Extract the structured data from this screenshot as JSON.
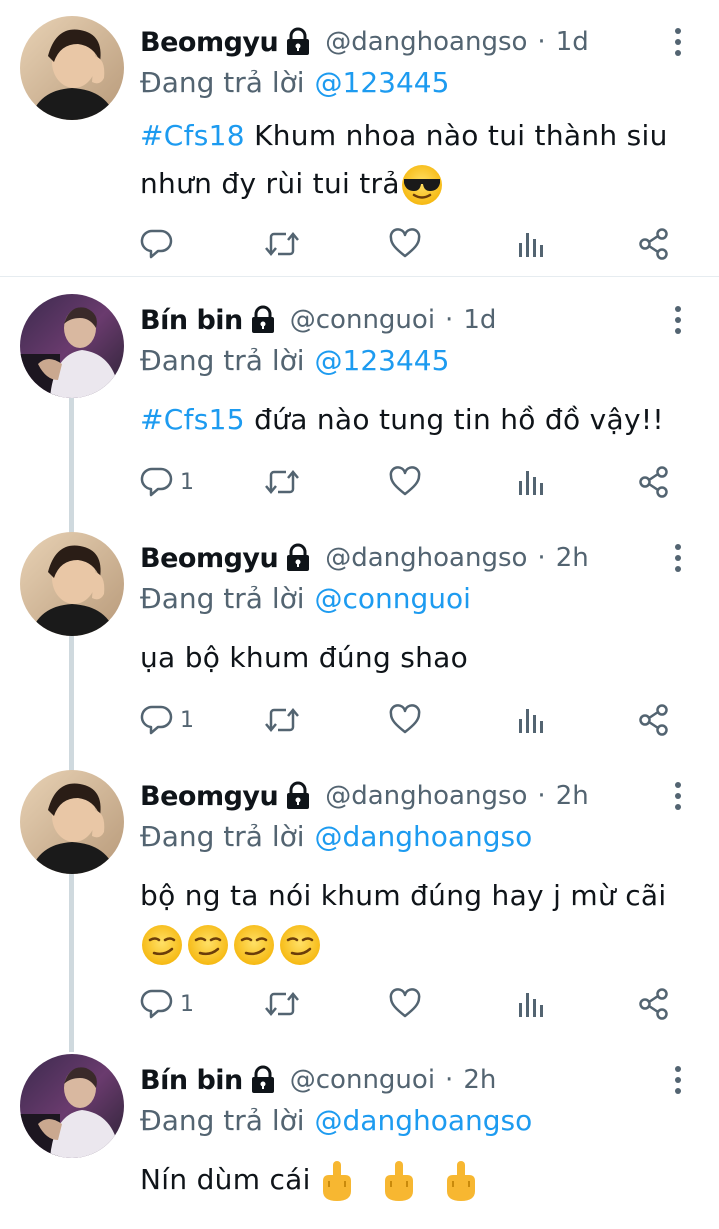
{
  "tweets": [
    {
      "name": "Beomgyu",
      "handle": "@danghoangso",
      "dot": "·",
      "time": "1d",
      "replying_label": "Đang trả lời",
      "replying_to": "@123445",
      "hashtag": "#Cfs18",
      "text": " Khum nhoa nào tui thành siu nhưn đy rùi tui trả",
      "emoji": "sunglasses-face",
      "reply_count": "",
      "avatar": "beomgyu"
    },
    {
      "name": "Bín bin",
      "handle": "@connguoi",
      "dot": "·",
      "time": "1d",
      "replying_label": "Đang trả lời",
      "replying_to": "@123445",
      "hashtag": "#Cfs15",
      "text": " đứa nào tung tin hồ đồ vậy!!",
      "reply_count": "1",
      "avatar": "binbin"
    },
    {
      "name": "Beomgyu",
      "handle": "@danghoangso",
      "dot": "·",
      "time": "2h",
      "replying_label": "Đang trả lời",
      "replying_to": "@connguoi",
      "text": "ụa bộ khum đúng shao",
      "reply_count": "1",
      "avatar": "beomgyu"
    },
    {
      "name": "Beomgyu",
      "handle": "@danghoangso",
      "dot": "·",
      "time": "2h",
      "replying_label": "Đang trả lời",
      "replying_to": "@danghoangso",
      "text": "bộ ng ta nói khum đúng hay j mừ cãi",
      "emoji": "smirking-face",
      "reply_count": "1",
      "avatar": "beomgyu"
    },
    {
      "name": "Bín bin",
      "handle": "@connguoi",
      "dot": "·",
      "time": "2h",
      "replying_label": "Đang trả lời",
      "replying_to": "@danghoangso",
      "text": "Nín dùm cái",
      "emoji": "middle-finger",
      "avatar": "binbin"
    }
  ],
  "icons": {
    "reply": "reply-icon",
    "retweet": "retweet-icon",
    "like": "like-icon",
    "views": "views-icon",
    "share": "share-icon",
    "more": "more-icon",
    "lock": "lock-icon"
  },
  "colors": {
    "accent": "#1d9bf0",
    "secondary": "#536471",
    "text": "#0f1419",
    "thread_line": "#cfd9de"
  }
}
